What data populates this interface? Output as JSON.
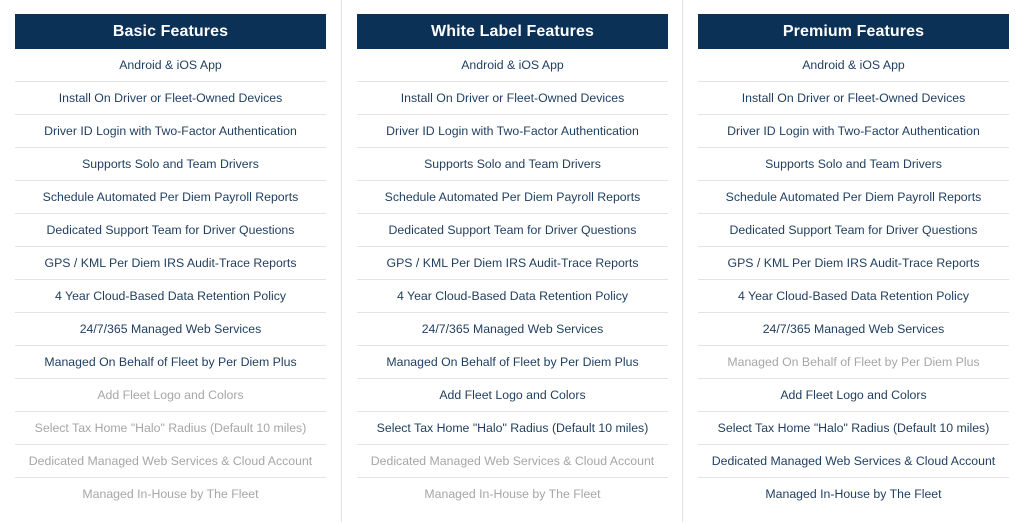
{
  "columns": [
    {
      "title": "Basic Features",
      "features": [
        {
          "label": "Android & iOS App",
          "included": true
        },
        {
          "label": "Install On Driver or Fleet-Owned Devices",
          "included": true
        },
        {
          "label": "Driver ID Login with Two-Factor Authentication",
          "included": true
        },
        {
          "label": "Supports Solo and Team Drivers",
          "included": true
        },
        {
          "label": "Schedule Automated Per Diem Payroll Reports",
          "included": true
        },
        {
          "label": "Dedicated Support Team for Driver Questions",
          "included": true
        },
        {
          "label": "GPS / KML Per Diem IRS Audit-Trace Reports",
          "included": true
        },
        {
          "label": "4 Year Cloud-Based Data Retention Policy",
          "included": true
        },
        {
          "label": "24/7/365 Managed Web Services",
          "included": true
        },
        {
          "label": "Managed On Behalf of Fleet by Per Diem Plus",
          "included": true
        },
        {
          "label": "Add Fleet Logo and Colors",
          "included": false
        },
        {
          "label": "Select Tax Home \"Halo\" Radius (Default 10 miles)",
          "included": false
        },
        {
          "label": "Dedicated Managed Web Services & Cloud Account",
          "included": false
        },
        {
          "label": "Managed In-House by The Fleet",
          "included": false
        }
      ]
    },
    {
      "title": "White Label Features",
      "features": [
        {
          "label": "Android & iOS App",
          "included": true
        },
        {
          "label": "Install On Driver or Fleet-Owned Devices",
          "included": true
        },
        {
          "label": "Driver ID Login with Two-Factor Authentication",
          "included": true
        },
        {
          "label": "Supports Solo and Team Drivers",
          "included": true
        },
        {
          "label": "Schedule Automated Per Diem Payroll Reports",
          "included": true
        },
        {
          "label": "Dedicated Support Team for Driver Questions",
          "included": true
        },
        {
          "label": "GPS / KML Per Diem IRS Audit-Trace Reports",
          "included": true
        },
        {
          "label": "4 Year Cloud-Based Data Retention Policy",
          "included": true
        },
        {
          "label": "24/7/365 Managed Web Services",
          "included": true
        },
        {
          "label": "Managed On Behalf of Fleet by Per Diem Plus",
          "included": true
        },
        {
          "label": "Add Fleet Logo and Colors",
          "included": true
        },
        {
          "label": "Select Tax Home \"Halo\" Radius (Default 10 miles)",
          "included": true
        },
        {
          "label": "Dedicated Managed Web Services & Cloud Account",
          "included": false
        },
        {
          "label": "Managed In-House by The Fleet",
          "included": false
        }
      ]
    },
    {
      "title": "Premium Features",
      "features": [
        {
          "label": "Android & iOS App",
          "included": true
        },
        {
          "label": "Install On Driver or Fleet-Owned Devices",
          "included": true
        },
        {
          "label": "Driver ID Login with Two-Factor Authentication",
          "included": true
        },
        {
          "label": "Supports Solo and Team Drivers",
          "included": true
        },
        {
          "label": "Schedule Automated Per Diem Payroll Reports",
          "included": true
        },
        {
          "label": "Dedicated Support Team for Driver Questions",
          "included": true
        },
        {
          "label": "GPS / KML Per Diem IRS Audit-Trace Reports",
          "included": true
        },
        {
          "label": "4 Year Cloud-Based Data Retention Policy",
          "included": true
        },
        {
          "label": "24/7/365 Managed Web Services",
          "included": true
        },
        {
          "label": "Managed On Behalf of Fleet by Per Diem Plus",
          "included": false
        },
        {
          "label": "Add Fleet Logo and Colors",
          "included": true
        },
        {
          "label": "Select Tax Home \"Halo\" Radius (Default 10 miles)",
          "included": true
        },
        {
          "label": "Dedicated Managed Web Services & Cloud Account",
          "included": true
        },
        {
          "label": "Managed In-House by The Fleet",
          "included": true
        }
      ]
    }
  ],
  "colors": {
    "header_bg": "#0b3157",
    "header_text": "#ffffff",
    "feature_included": "#1e3d5e",
    "feature_excluded": "#a6a6a6",
    "divider": "#e3e3e3"
  }
}
